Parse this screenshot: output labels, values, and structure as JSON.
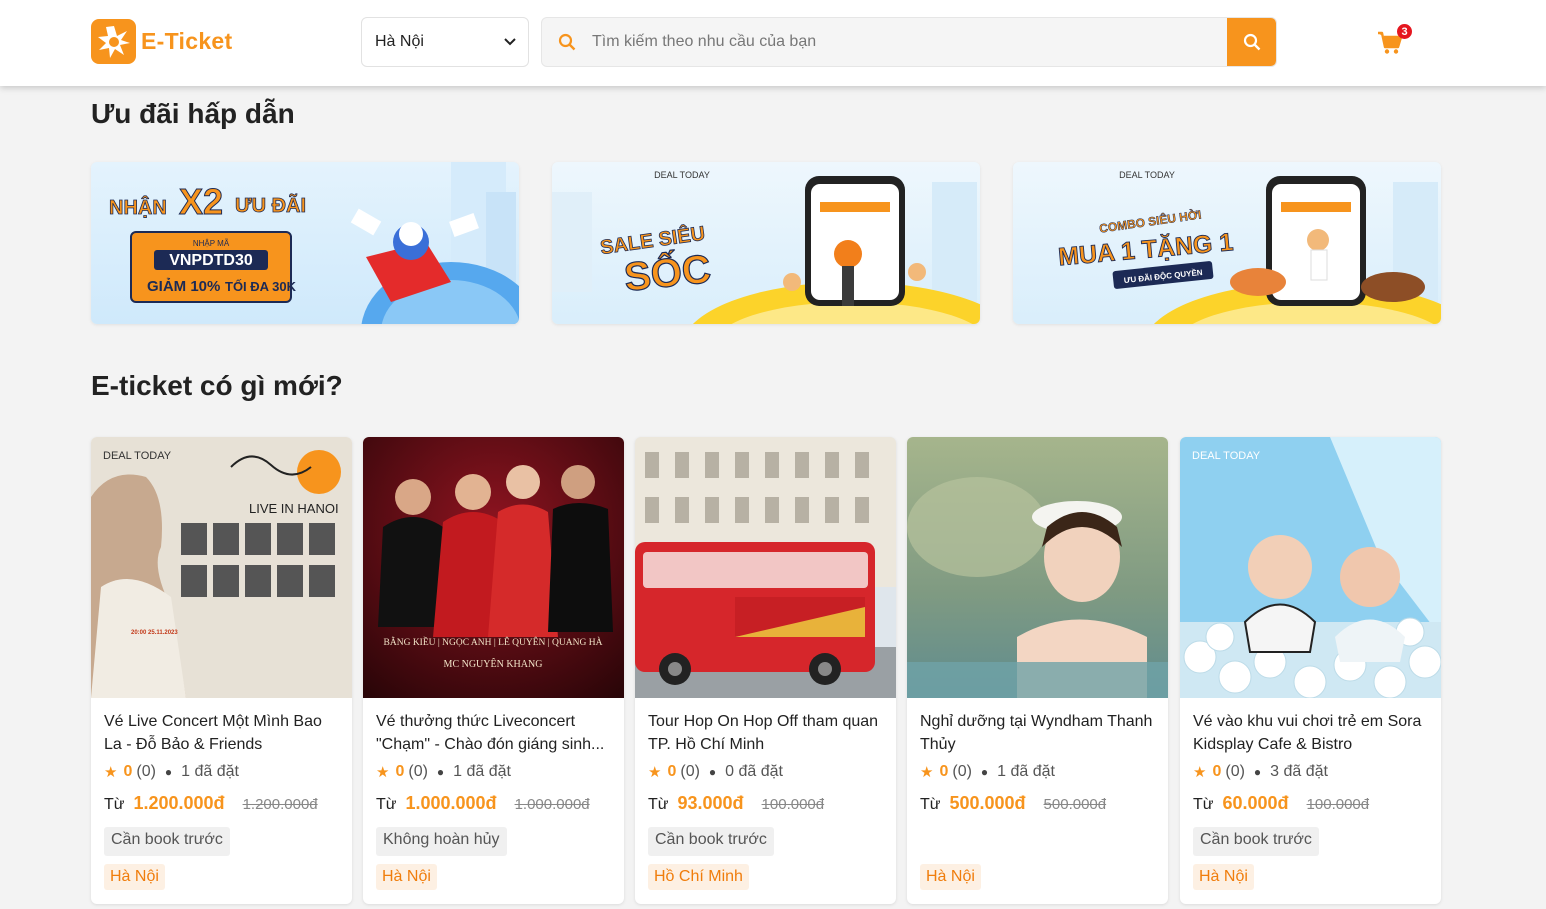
{
  "header": {
    "logo_text": "E-Ticket",
    "city": "Hà Nội",
    "search_placeholder": "Tìm kiếm theo nhu cầu của bạn",
    "cart_count": "3"
  },
  "sections": {
    "promos_title": "Ưu đãi hấp dẫn",
    "new_title": "E-ticket có gì mới?"
  },
  "promos": [
    {
      "line1": "NHẬN",
      "big": "X2",
      "line2": "ƯU ĐÃI",
      "code_label": "NHẬP MÃ",
      "code": "VNPDTD30",
      "discount": "GIẢM 10%",
      "max": "TỐI ĐA 30K"
    },
    {
      "brand": "DEAL TODAY",
      "line1": "SALE SIÊU",
      "line2": "SỐC"
    },
    {
      "brand": "DEAL TODAY",
      "line1": "COMBO SIÊU HỜI",
      "line2": "MUA 1 TẶNG 1",
      "line3": "ƯU ĐÃI ĐỘC QUYỀN"
    }
  ],
  "cards": [
    {
      "title": "Vé Live Concert Một Mình Bao La - Đỗ Bảo & Friends",
      "rating": "0",
      "reviews": "(0)",
      "sold": "1 đã đặt",
      "from": "Từ",
      "price": "1.200.000đ",
      "old_price": "1.200.000đ",
      "tag": "Cần book trước",
      "location": "Hà Nội",
      "img_brand": "DEAL TODAY",
      "img_text": "LIVE IN HANOI",
      "img_date": "20:00 25.11.2023"
    },
    {
      "title": "Vé thưởng thức Liveconcert \"Chạm\" - Chào đón giáng sinh...",
      "rating": "0",
      "reviews": "(0)",
      "sold": "1 đã đặt",
      "from": "Từ",
      "price": "1.000.000đ",
      "old_price": "1.000.000đ",
      "tag": "Không hoàn hủy",
      "location": "Hà Nội",
      "img_text": "BẰNG KIỀU | NGỌC ANH | LÊ QUYÊN | QUANG HÀ",
      "img_mc": "MC NGUYÊN KHANG"
    },
    {
      "title": "Tour Hop On Hop Off tham quan TP. Hồ Chí Minh",
      "rating": "0",
      "reviews": "(0)",
      "sold": "0 đã đặt",
      "from": "Từ",
      "price": "93.000đ",
      "old_price": "100.000đ",
      "tag": "Cần book trước",
      "location": "Hồ Chí Minh"
    },
    {
      "title": "Nghỉ dưỡng tại Wyndham Thanh Thủy",
      "rating": "0",
      "reviews": "(0)",
      "sold": "1 đã đặt",
      "from": "Từ",
      "price": "500.000đ",
      "old_price": "500.000đ",
      "tag": "",
      "location": "Hà Nội"
    },
    {
      "title": "Vé vào khu vui chơi trẻ em Sora Kidsplay Cafe & Bistro",
      "rating": "0",
      "reviews": "(0)",
      "sold": "3 đã đặt",
      "from": "Từ",
      "price": "60.000đ",
      "old_price": "100.000đ",
      "tag": "Cần book trước",
      "location": "Hà Nội",
      "img_brand": "DEAL TODAY"
    }
  ],
  "colors": {
    "brand": "#f7941d",
    "badge": "#e5161f",
    "location_bg": "#fdf0e3"
  }
}
